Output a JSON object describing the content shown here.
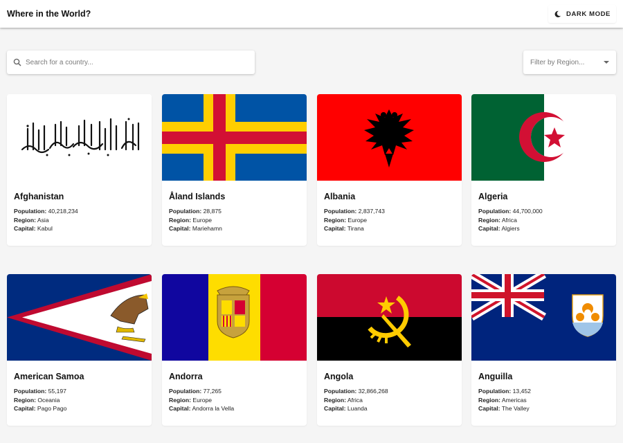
{
  "header": {
    "title": "Where in the World?",
    "mode_label": "DARK MODE"
  },
  "search": {
    "placeholder": "Search for a country..."
  },
  "filter": {
    "label": "Filter by Region..."
  },
  "labels": {
    "population": "Population:",
    "region": "Region:",
    "capital": "Capital:"
  },
  "countries": [
    {
      "name": "Afghanistan",
      "population": "40,218,234",
      "region": "Asia",
      "capital": "Kabul"
    },
    {
      "name": "Åland Islands",
      "population": "28,875",
      "region": "Europe",
      "capital": "Mariehamn"
    },
    {
      "name": "Albania",
      "population": "2,837,743",
      "region": "Europe",
      "capital": "Tirana"
    },
    {
      "name": "Algeria",
      "population": "44,700,000",
      "region": "Africa",
      "capital": "Algiers"
    },
    {
      "name": "American Samoa",
      "population": "55,197",
      "region": "Oceania",
      "capital": "Pago Pago"
    },
    {
      "name": "Andorra",
      "population": "77,265",
      "region": "Europe",
      "capital": "Andorra la Vella"
    },
    {
      "name": "Angola",
      "population": "32,866,268",
      "region": "Africa",
      "capital": "Luanda"
    },
    {
      "name": "Anguilla",
      "population": "13,452",
      "region": "Americas",
      "capital": "The Valley"
    }
  ]
}
